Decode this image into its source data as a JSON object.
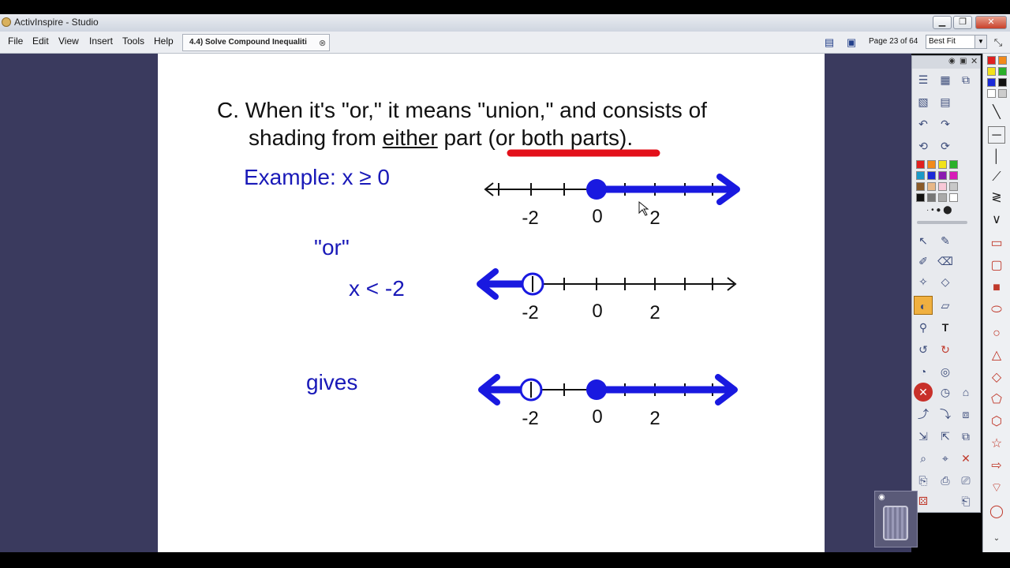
{
  "window": {
    "title": "ActivInspire - Studio"
  },
  "menu": [
    "File",
    "Edit",
    "View",
    "Insert",
    "Tools",
    "Help"
  ],
  "document_tab": {
    "label": "4.4) Solve Compound Inequaliti"
  },
  "page_indicator": "Page 23 of 64",
  "zoom": {
    "value": "Best Fit"
  },
  "slide": {
    "heading_prefix": "C. When it's \"or,\" it means \"union,\" and consists of",
    "line2_start": "shading from ",
    "line2_underlined": "either",
    "line2_mid": " part ",
    "line2_highlight": "(or both parts)",
    "line2_end": ".",
    "example_label": "Example:  x ≥ 0",
    "or_label": "\"or\"",
    "second_ineq": "x < -2",
    "gives_label": "gives",
    "number_lines": [
      {
        "tick_labels": [
          "-2",
          "0",
          "2"
        ],
        "point": 0,
        "point_type": "closed",
        "shade": "right"
      },
      {
        "tick_labels": [
          "-2",
          "0",
          "2"
        ],
        "point": -2,
        "point_type": "open",
        "shade": "left"
      },
      {
        "tick_labels": [
          "-2",
          "0",
          "2"
        ],
        "points": [
          -2,
          0
        ],
        "point_types": [
          "open",
          "closed"
        ],
        "shade": "both_outer"
      }
    ]
  },
  "colors": {
    "ink_blue": "#1919b8",
    "highlight_red": "#e3101a",
    "side_panel": "#3a3a5e"
  }
}
